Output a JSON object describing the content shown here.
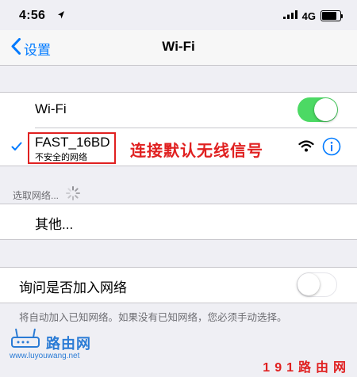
{
  "status_bar": {
    "time": "4:56",
    "network": "4G"
  },
  "nav": {
    "back_label": "设置",
    "title": "Wi-Fi"
  },
  "wifi_group": {
    "toggle_label": "Wi-Fi",
    "toggle_on": true,
    "connected_network": {
      "name": "FAST_16BD",
      "subtitle": "不安全的网络"
    },
    "annotation": "连接默认无线信号"
  },
  "choose_network": {
    "header": "选取网络...",
    "other_label": "其他..."
  },
  "ask_join": {
    "label": "询问是否加入网络",
    "toggle_on": false,
    "footer": "将自动加入已知网络。如果没有已知网络，您必须手动选择。"
  },
  "watermark": {
    "text": "路由网",
    "url": "www.luyouwang.net",
    "brand": "191路由网"
  },
  "colors": {
    "accent": "#007aff",
    "toggle_on": "#4cd964",
    "annotation": "#e02020"
  }
}
